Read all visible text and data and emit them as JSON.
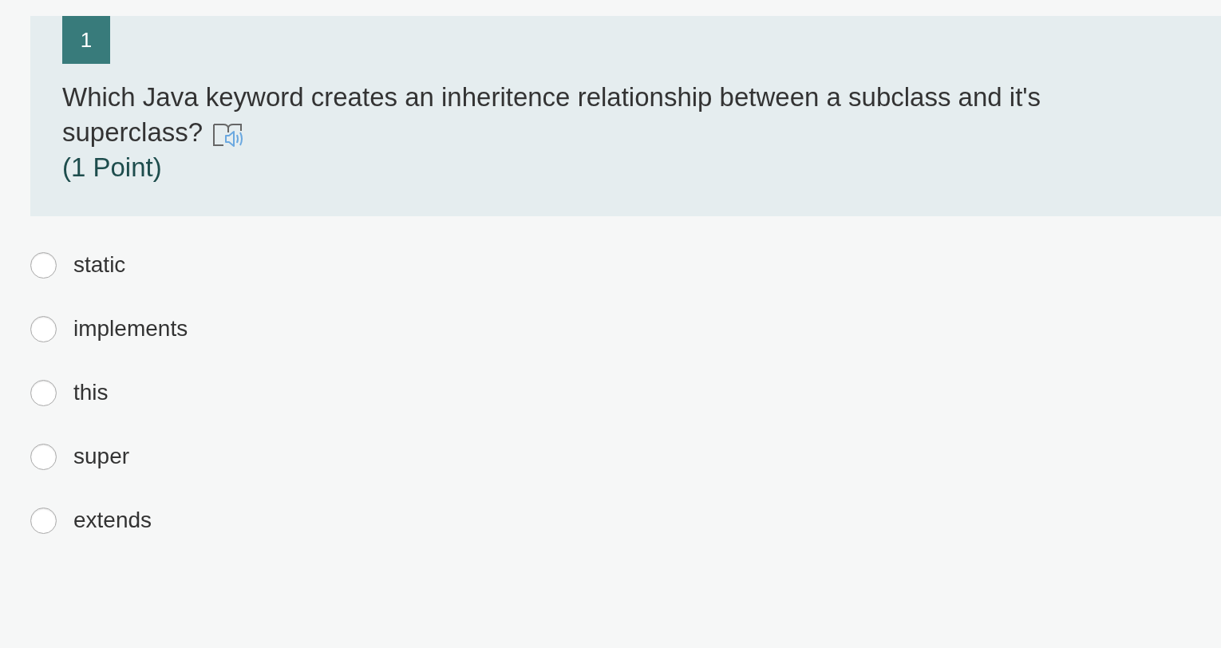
{
  "question": {
    "number": "1",
    "text": "Which Java keyword creates an inheritence relationship between a subclass and it's superclass?",
    "points": "(1 Point)"
  },
  "options": [
    {
      "label": "static",
      "selected": false
    },
    {
      "label": "implements",
      "selected": false
    },
    {
      "label": "this",
      "selected": false
    },
    {
      "label": "super",
      "selected": false
    },
    {
      "label": "extends",
      "selected": false
    }
  ]
}
